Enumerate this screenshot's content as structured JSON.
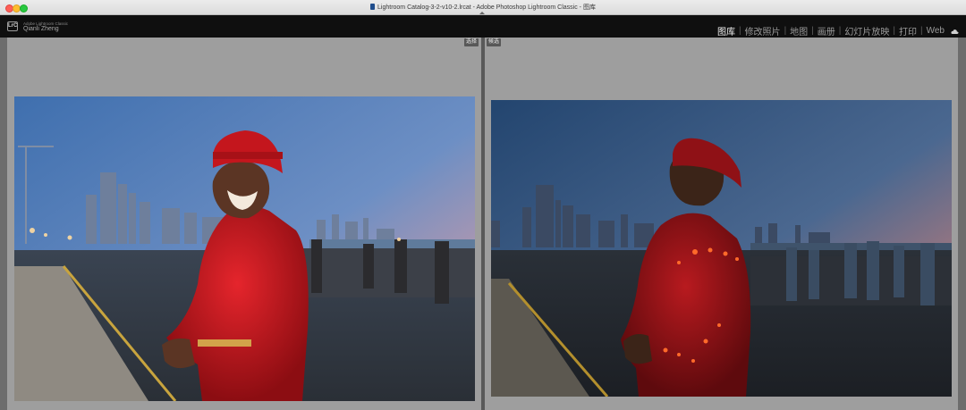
{
  "window": {
    "title": "Lightroom Catalog-3-2-v10-2.lrcat - Adobe Photoshop Lightroom Classic - 图库"
  },
  "identity": {
    "logo": "LrC",
    "app_name": "Adobe Lightroom Classic",
    "user_name": "Qianli Zheng"
  },
  "modules": {
    "items": [
      "图库",
      "修改照片",
      "地图",
      "画册",
      "幻灯片放映",
      "打印",
      "Web"
    ],
    "active": "图库",
    "separator": "|"
  },
  "compare": {
    "left_label": "选择",
    "right_label": "候选"
  },
  "icons": [
    "doc-icon",
    "collapse-arrow-icon",
    "cloud-sync-icon"
  ]
}
